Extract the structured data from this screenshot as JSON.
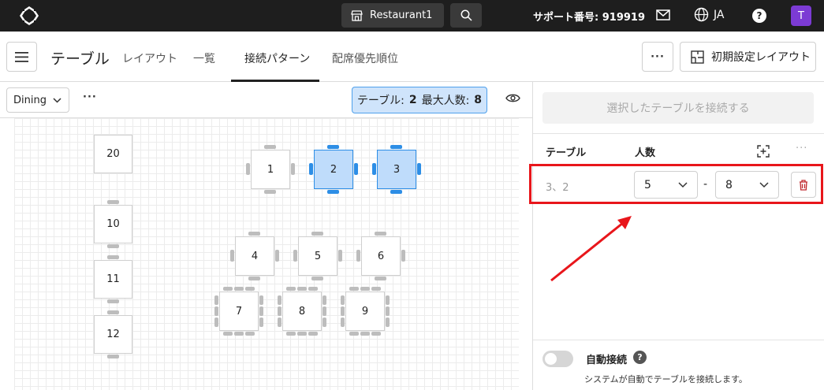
{
  "topbar": {
    "restaurant_label": "Restaurant1",
    "support_text": "サポート番号: 919919",
    "lang": "JA",
    "help_glyph": "?",
    "avatar_initial": "T",
    "avatar_color": "#7c3bd4"
  },
  "header": {
    "title": "テーブル",
    "tabs": [
      {
        "label": "レイアウト",
        "active": false
      },
      {
        "label": "一覧",
        "active": false
      },
      {
        "label": "接続パターン",
        "active": true
      },
      {
        "label": "配席優先順位",
        "active": false
      }
    ],
    "more_label": "···",
    "init_layout_label": "初期設定レイアウト"
  },
  "toolbar": {
    "area_select": "Dining",
    "more_label": "···",
    "summary_tables_label": "テーブル:",
    "summary_tables_value": "2",
    "summary_max_label": "最大人数:",
    "summary_max_value": "8"
  },
  "tables": [
    {
      "label": "20",
      "selected": false
    },
    {
      "label": "10",
      "selected": false
    },
    {
      "label": "11",
      "selected": false
    },
    {
      "label": "12",
      "selected": false
    },
    {
      "label": "1",
      "selected": false
    },
    {
      "label": "2",
      "selected": true
    },
    {
      "label": "3",
      "selected": true
    },
    {
      "label": "4",
      "selected": false
    },
    {
      "label": "5",
      "selected": false
    },
    {
      "label": "6",
      "selected": false
    },
    {
      "label": "7",
      "selected": false
    },
    {
      "label": "8",
      "selected": false
    },
    {
      "label": "9",
      "selected": false
    }
  ],
  "panel": {
    "connect_button": "選択したテーブルを接続する",
    "col_table": "テーブル",
    "col_people": "人数",
    "col_more": "···",
    "rows": [
      {
        "tables": "3、2",
        "min": "5",
        "dash": "-",
        "max": "8"
      }
    ],
    "auto_connect_label": "自動接続",
    "auto_help_glyph": "?",
    "auto_connect_desc": "システムが自動でテーブルを接続します。"
  },
  "colors": {
    "accent": "#2d8ee6",
    "selected_fill": "#bfdcfb",
    "highlight_red": "#e8161b",
    "topbar_bg": "#1e1e1e"
  }
}
